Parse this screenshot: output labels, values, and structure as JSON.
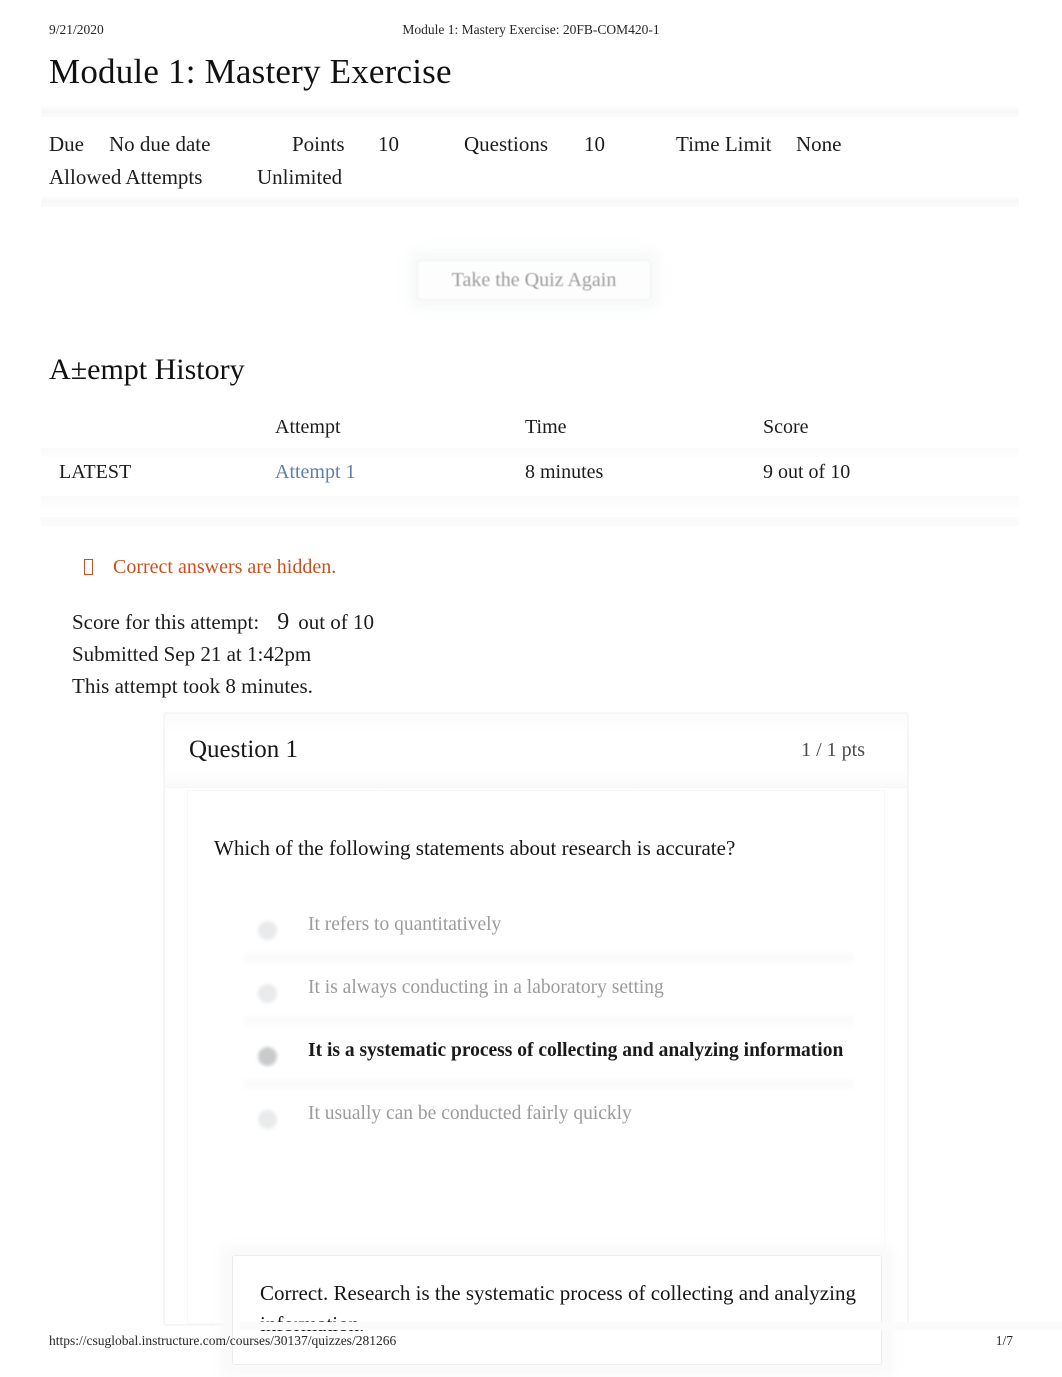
{
  "print_header": {
    "date": "9/21/2020",
    "document_title": "Module 1: Mastery Exercise: 20FB-COM420-1"
  },
  "page_title": "Module 1: Mastery Exercise",
  "quiz_meta": {
    "due_label": "Due",
    "due_value": "No due date",
    "points_label": "Points",
    "points_value": "10",
    "questions_label": "Questions",
    "questions_value": "10",
    "time_limit_label": "Time Limit",
    "time_limit_value": "None",
    "allowed_attempts_label": "Allowed Attempts",
    "allowed_attempts_value": "Unlimited"
  },
  "retake_button": {
    "label": "Take the Quiz Again"
  },
  "attempt_history": {
    "heading": "A±empt History",
    "columns": {
      "kept": "",
      "attempt": "Attempt",
      "time": "Time",
      "score": "Score"
    },
    "rows": [
      {
        "kept": "LATEST",
        "attempt": "Attempt 1",
        "time": "8 minutes",
        "score": "9 out of 10"
      }
    ]
  },
  "hidden_notice": {
    "icon": "missing-glyph-box-icon",
    "text": "Correct answers are hidden.",
    "color": "#d04e1e"
  },
  "attempt_summary": {
    "score_label": "Score for this attempt:",
    "score_value": "9",
    "score_suffix": "out of 10",
    "submitted": "Submitted Sep 21 at 1:42pm",
    "duration": "This attempt took 8 minutes."
  },
  "question": {
    "title": "Question 1",
    "points": "1 / 1 pts",
    "prompt": "Which of the following statements about research is accurate?",
    "answers": [
      {
        "text": "It refers to quantitatively",
        "selected": false
      },
      {
        "text": "It is always conducting in a laboratory setting",
        "selected": false
      },
      {
        "text": "It is a systematic process of collecting and analyzing information",
        "selected": true
      },
      {
        "text": "It usually can be conducted fairly quickly",
        "selected": false
      }
    ],
    "feedback": "Correct. Research is the systematic process of collecting and analyzing information."
  },
  "print_footer": {
    "url": "https://csuglobal.instructure.com/courses/30137/quizzes/281266",
    "page": "1/7"
  }
}
